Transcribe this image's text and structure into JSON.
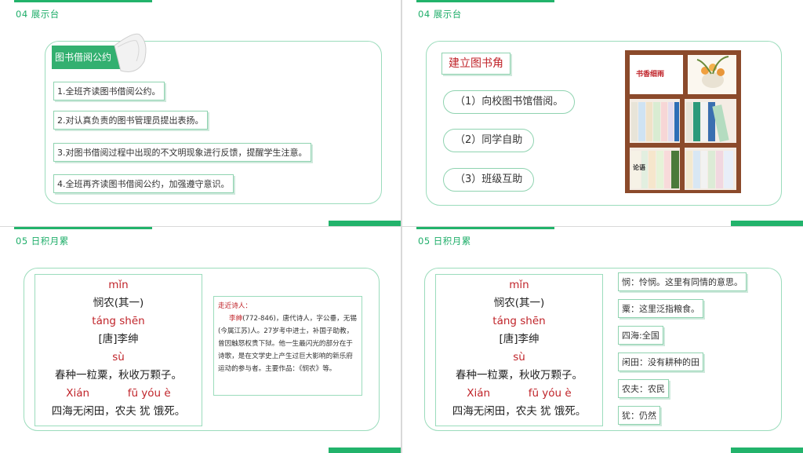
{
  "slide1": {
    "header": "04 展示台",
    "tag": "图书借阅公约",
    "items": [
      "1.全班齐读图书借阅公约。",
      "2.对认真负责的图书管理员提出表扬。",
      "3.对图书借阅过程中出现的不文明现象进行反馈，提醒学生注意。",
      "4.全班再齐读图书借阅公约，加强遵守意识。"
    ]
  },
  "slide2": {
    "header": "04 展示台",
    "title": "建立图书角",
    "options": [
      "（1）向校图书馆借阅。",
      "（2）同学自助",
      "（3）班级互助"
    ],
    "shelf_sign": "书香细雨",
    "book_label": "论语"
  },
  "slide3": {
    "header": "05 日积月累",
    "poem": {
      "pinyin1": "mǐn",
      "title": "悯农(其一)",
      "pinyin2": "táng shēn",
      "author": "[唐]李绅",
      "pinyin3": "sù",
      "line1": "春种一粒粟，秋收万颗子。",
      "pinyin4a": "Xián",
      "pinyin4b": "fū yóu è",
      "line2": "四海无闲田，农夫 犹 饿死。"
    },
    "note": {
      "heading": "走近诗人：",
      "name": "李绅",
      "body": "(772-846)，唐代诗人，字公垂，无锡(今属江苏)人。27岁考中进士，补国子助教，曾因触怒权贵下狱。他一生最闪光的部分在于诗歌，是在文学史上产生过巨大影响的新乐府运动的参与者。主要作品：《悯农》等。"
    }
  },
  "slide4": {
    "header": "05 日积月累",
    "poem": {
      "pinyin1": "mǐn",
      "title": "悯农(其一)",
      "pinyin2": "táng shēn",
      "author": "[唐]李绅",
      "pinyin3": "sù",
      "line1": "春种一粒粟，秋收万颗子。",
      "pinyin4a": "Xián",
      "pinyin4b": "fū yóu è",
      "line2": "四海无闲田，农夫 犹 饿死。"
    },
    "glossary": [
      "悯：怜悯。这里有同情的意思。",
      "粟：这里泛指粮食。",
      "四海:全国",
      "闲田：没有耕种的田",
      "农夫：农民",
      "犹：仍然"
    ]
  }
}
